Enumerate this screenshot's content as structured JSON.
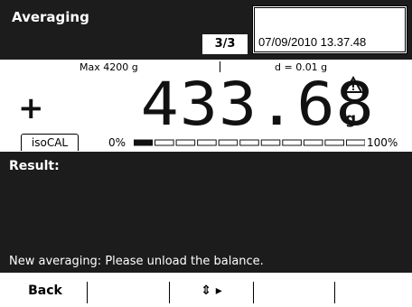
{
  "header": {
    "title": "Averaging",
    "page_counter": "3/3",
    "datetime": "07/09/2010 13.37.48"
  },
  "spec": {
    "max_capacity": "Max 4200 g",
    "readability": "d = 0.01 g"
  },
  "reading": {
    "sign": "+",
    "value": "433.68",
    "unit": "g",
    "icon": "warning-triangle-icon"
  },
  "isocal": {
    "label": "isoCAL"
  },
  "capacity_bar": {
    "min_label": "0%",
    "max_label": "100%",
    "fill_fraction": 0.1,
    "segments": 11
  },
  "result": {
    "label": "Result:",
    "message": "New averaging: Please unload the balance."
  },
  "softkeys": {
    "key1": "Back",
    "key2": "",
    "key3": "⇕ ▸",
    "key4": "",
    "key5": ""
  },
  "colors": {
    "panel": "#1c1c1c",
    "background": "#ffffff"
  }
}
